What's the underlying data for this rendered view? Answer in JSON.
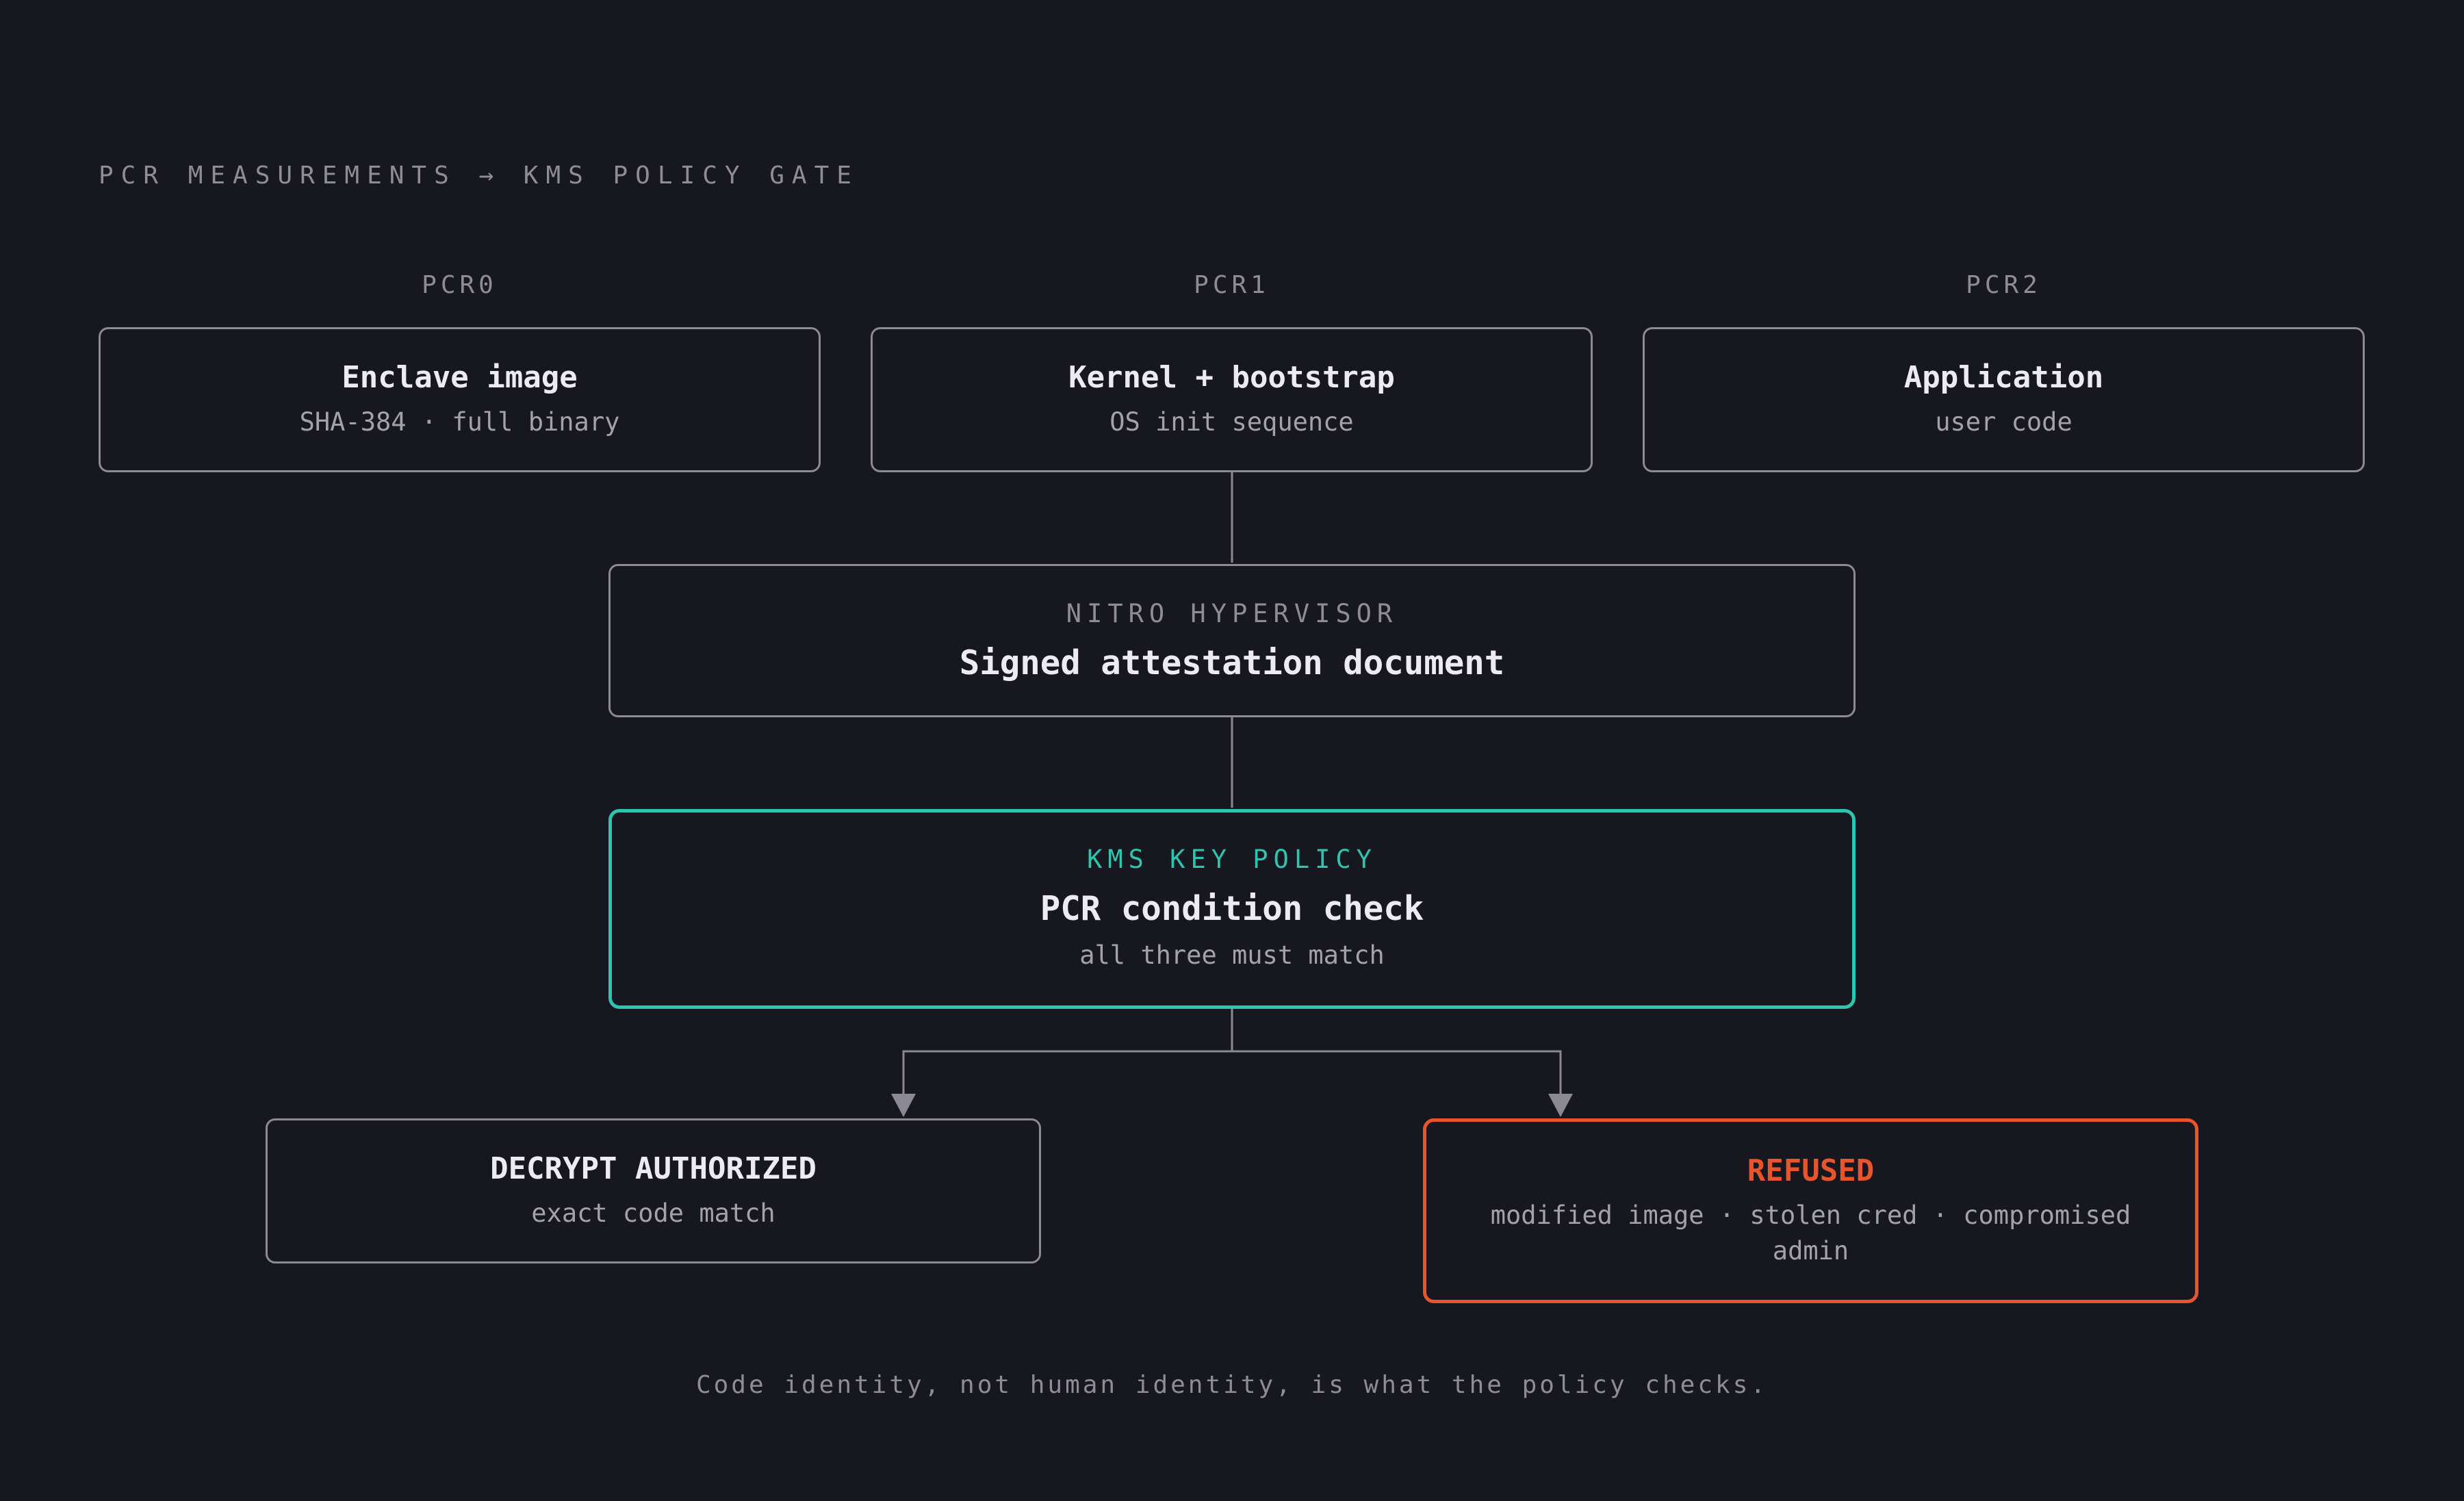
{
  "header": {
    "title": "PCR MEASUREMENTS → KMS POLICY GATE"
  },
  "pcrs": [
    {
      "label": "PCR0",
      "title": "Enclave image",
      "subtitle": "SHA-384 · full binary"
    },
    {
      "label": "PCR1",
      "title": "Kernel + bootstrap",
      "subtitle": "OS init sequence"
    },
    {
      "label": "PCR2",
      "title": "Application",
      "subtitle": "user code"
    }
  ],
  "hypervisor": {
    "kicker": "NITRO HYPERVISOR",
    "title": "Signed attestation document"
  },
  "policy": {
    "kicker": "KMS KEY POLICY",
    "title": "PCR condition check",
    "subtitle": "all three must match"
  },
  "outcomes": {
    "authorized": {
      "title": "DECRYPT AUTHORIZED",
      "subtitle": "exact code match"
    },
    "refused": {
      "title": "REFUSED",
      "subtitle": "modified image · stolen cred · compromised admin"
    }
  },
  "footer": {
    "note": "Code identity, not human identity, is what the policy checks."
  },
  "colors": {
    "background": "#17171f",
    "policy_accent": "#2ec4b0",
    "refused_accent": "#e8552c",
    "border": "#8b8a94"
  }
}
